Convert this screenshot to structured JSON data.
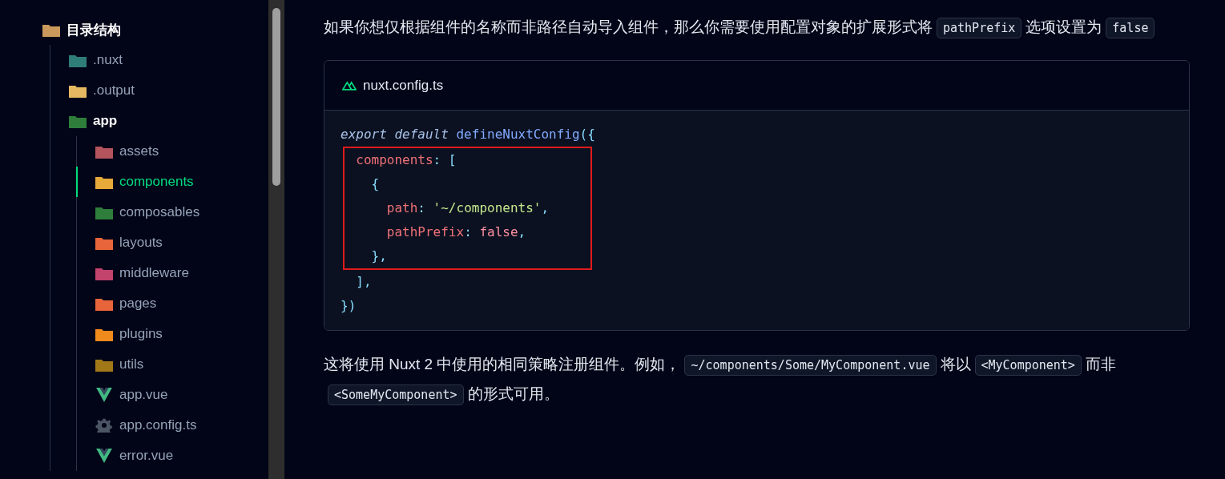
{
  "sidebar": {
    "tree": {
      "label": "目录结构",
      "kind": "folder",
      "color": "#c99a5b",
      "expanded": true,
      "children": [
        {
          "label": ".nuxt",
          "kind": "folder",
          "color": "#2f7d78",
          "expanded": false,
          "selected": false
        },
        {
          "label": ".output",
          "kind": "folder",
          "color": "#e6b862",
          "expanded": false,
          "selected": false
        },
        {
          "label": "app",
          "kind": "folder",
          "color": "#2e7d3a",
          "expanded": true,
          "selected": false,
          "children": [
            {
              "label": "assets",
              "kind": "folder",
              "color": "#b4545c",
              "expanded": false,
              "selected": false
            },
            {
              "label": "components",
              "kind": "folder",
              "color": "#e6a93a",
              "expanded": false,
              "selected": true
            },
            {
              "label": "composables",
              "kind": "folder",
              "color": "#2e7d3a",
              "expanded": false,
              "selected": false
            },
            {
              "label": "layouts",
              "kind": "folder",
              "color": "#e8643a",
              "expanded": false,
              "selected": false
            },
            {
              "label": "middleware",
              "kind": "folder",
              "color": "#c2436c",
              "expanded": false,
              "selected": false
            },
            {
              "label": "pages",
              "kind": "folder",
              "color": "#e8643a",
              "expanded": false,
              "selected": false
            },
            {
              "label": "plugins",
              "kind": "folder",
              "color": "#f08a1c",
              "expanded": false,
              "selected": false
            },
            {
              "label": "utils",
              "kind": "folder",
              "color": "#a07818",
              "expanded": false,
              "selected": false
            },
            {
              "label": "app.vue",
              "kind": "vue",
              "expanded": false,
              "selected": false
            },
            {
              "label": "app.config.ts",
              "kind": "gear",
              "expanded": false,
              "selected": false
            },
            {
              "label": "error.vue",
              "kind": "vue",
              "expanded": false,
              "selected": false
            }
          ]
        }
      ]
    }
  },
  "content": {
    "intro": [
      {
        "kind": "text",
        "text": "如果你想仅根据组件的名称而非路径自动导入组件，那么你需要使用配置对象的扩展形式将"
      },
      {
        "kind": "code",
        "text": "pathPrefix"
      },
      {
        "kind": "text",
        "text": "选项设置为"
      },
      {
        "kind": "code",
        "text": "false"
      }
    ],
    "code_block": {
      "filename": "nuxt.config.ts",
      "lines": [
        {
          "highlighted": false,
          "tokens": [
            {
              "kind": "keyword",
              "text": "export"
            },
            {
              "kind": "keyword",
              "text": "default"
            },
            {
              "kind": "function",
              "text": "defineNuxtConfig"
            },
            {
              "kind": "punct",
              "text": "({"
            }
          ]
        },
        {
          "highlighted": true,
          "tokens": [
            {
              "kind": "property",
              "text": "components"
            },
            {
              "kind": "punct",
              "text": ": ["
            }
          ]
        },
        {
          "highlighted": true,
          "tokens": [
            {
              "kind": "punct",
              "text": "{"
            }
          ]
        },
        {
          "highlighted": true,
          "tokens": [
            {
              "kind": "property",
              "text": "path"
            },
            {
              "kind": "punct",
              "text": ": "
            },
            {
              "kind": "string",
              "text": "'~/components'"
            },
            {
              "kind": "punct",
              "text": ","
            }
          ]
        },
        {
          "highlighted": true,
          "tokens": [
            {
              "kind": "property",
              "text": "pathPrefix"
            },
            {
              "kind": "punct",
              "text": ": "
            },
            {
              "kind": "boolean",
              "text": "false"
            },
            {
              "kind": "punct",
              "text": ","
            }
          ]
        },
        {
          "highlighted": true,
          "tokens": [
            {
              "kind": "punct",
              "text": "},"
            }
          ]
        },
        {
          "highlighted": false,
          "tokens": [
            {
              "kind": "punct",
              "text": "],"
            }
          ]
        },
        {
          "highlighted": false,
          "tokens": [
            {
              "kind": "punct",
              "text": "})"
            }
          ]
        }
      ]
    },
    "outro": [
      {
        "kind": "text",
        "text": "这将使用 Nuxt 2 中使用的相同策略注册组件。例如，"
      },
      {
        "kind": "code",
        "text": "~/components/Some/MyComponent.vue"
      },
      {
        "kind": "text",
        "text": "将以"
      },
      {
        "kind": "code",
        "text": "<MyComponent>"
      },
      {
        "kind": "text",
        "text": "而非"
      },
      {
        "kind": "code",
        "text": "<SomeMyComponent>"
      },
      {
        "kind": "text",
        "text": "的形式可用。"
      }
    ]
  }
}
